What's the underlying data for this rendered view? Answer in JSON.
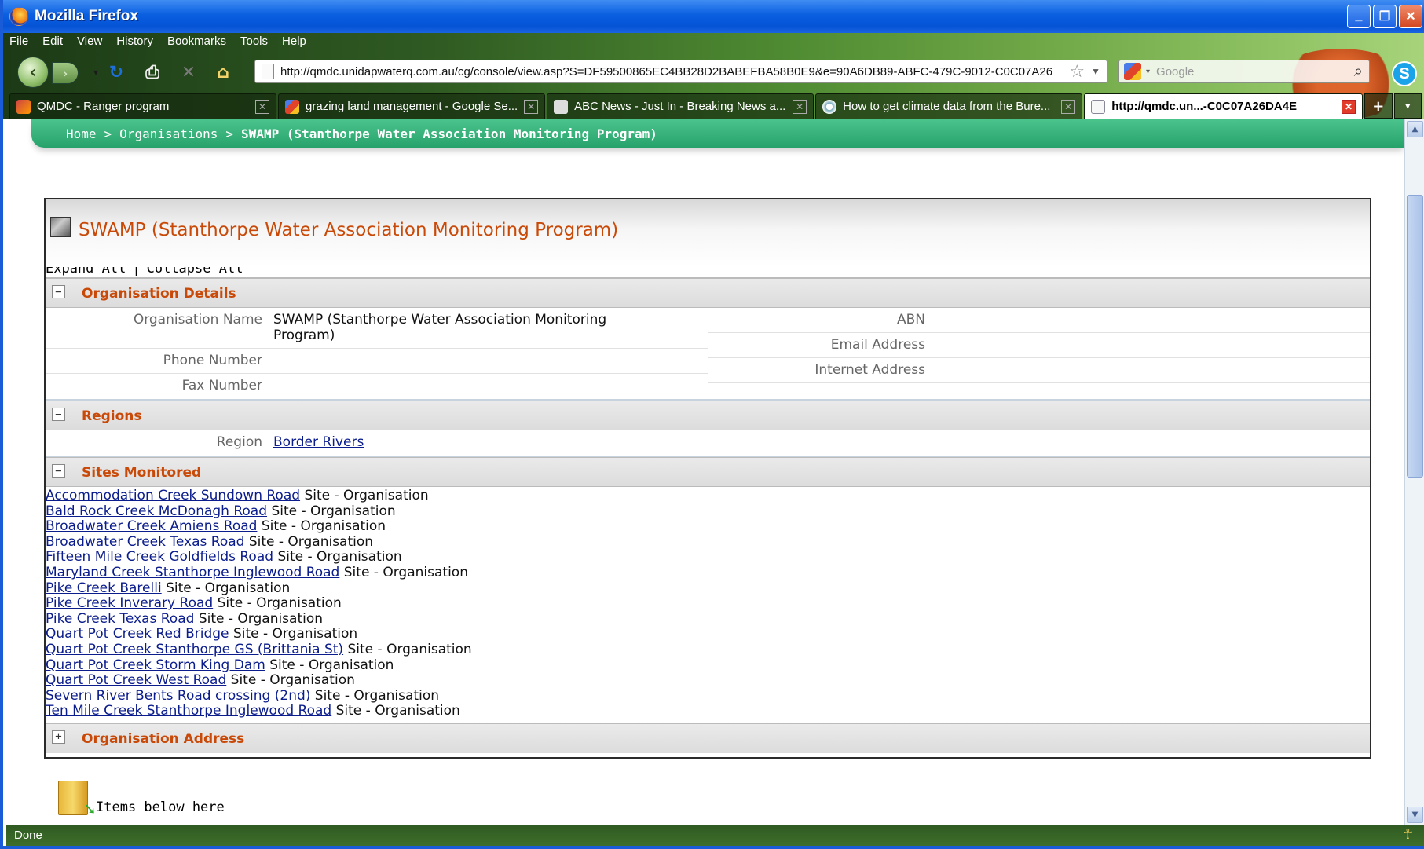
{
  "window": {
    "title": "Mozilla Firefox"
  },
  "menu": [
    "File",
    "Edit",
    "View",
    "History",
    "Bookmarks",
    "Tools",
    "Help"
  ],
  "navigation": {
    "url": "http://qmdc.unidapwaterq.com.au/cg/console/view.asp?S=DF59500865EC4BB28D2BABEFBA58B0E9&e=90A6DB89-ABFC-479C-9012-C0C07A26",
    "search_placeholder": "Google"
  },
  "tabs": [
    {
      "label": "QMDC - Ranger program",
      "icon": "ranger-icon"
    },
    {
      "label": "grazing land management - Google Se...",
      "icon": "google-icon"
    },
    {
      "label": "ABC News - Just In - Breaking News a...",
      "icon": "abc-icon"
    },
    {
      "label": "How to get climate data from the Bure...",
      "icon": "globe-icon"
    },
    {
      "label": "http://qmdc.un...-C0C07A26DA4E",
      "icon": "page-icon",
      "active": true
    }
  ],
  "breadcrumb": {
    "home": "Home",
    "sep1": ">",
    "organisations": "Organisations",
    "sep2": ">",
    "current": "SWAMP (Stanthorpe Water Association Monitoring Program)"
  },
  "panel": {
    "title": "SWAMP (Stanthorpe Water Association Monitoring Program)",
    "expand_all": "Expand All",
    "separator": "|",
    "collapse_all": "Collapse All"
  },
  "org_details": {
    "section_title": "Organisation Details",
    "toggle": "−",
    "left": [
      {
        "label": "Organisation Name",
        "value": "SWAMP (Stanthorpe Water Association Monitoring Program)"
      },
      {
        "label": "Phone Number",
        "value": ""
      },
      {
        "label": "Fax Number",
        "value": ""
      }
    ],
    "right": [
      {
        "label": "ABN",
        "value": ""
      },
      {
        "label": "Email Address",
        "value": ""
      },
      {
        "label": "Internet Address",
        "value": ""
      }
    ]
  },
  "regions": {
    "section_title": "Regions",
    "toggle": "−",
    "label": "Region",
    "value": "Border Rivers"
  },
  "sites": {
    "section_title": "Sites Monitored",
    "toggle": "−",
    "items": [
      {
        "name": "Accommodation Creek Sundown Road",
        "type": "Site - Organisation"
      },
      {
        "name": "Bald Rock Creek McDonagh Road",
        "type": "Site - Organisation"
      },
      {
        "name": "Broadwater Creek Amiens Road",
        "type": "Site - Organisation"
      },
      {
        "name": "Broadwater Creek Texas Road",
        "type": "Site - Organisation"
      },
      {
        "name": "Fifteen Mile Creek Goldfields Road",
        "type": "Site - Organisation"
      },
      {
        "name": "Maryland Creek Stanthorpe Inglewood Road",
        "type": "Site - Organisation"
      },
      {
        "name": "Pike Creek Barelli",
        "type": "Site - Organisation"
      },
      {
        "name": "Pike Creek Inverary Road",
        "type": "Site - Organisation"
      },
      {
        "name": "Pike Creek Texas Road",
        "type": "Site - Organisation"
      },
      {
        "name": "Quart Pot Creek Red Bridge",
        "type": "Site - Organisation"
      },
      {
        "name": "Quart Pot Creek Stanthorpe GS (Brittania St)",
        "type": "Site - Organisation"
      },
      {
        "name": "Quart Pot Creek Storm King Dam",
        "type": "Site - Organisation"
      },
      {
        "name": "Quart Pot Creek West Road",
        "type": "Site - Organisation"
      },
      {
        "name": "Severn River Bents Road crossing (2nd)",
        "type": "Site - Organisation"
      },
      {
        "name": "Ten Mile Creek Stanthorpe Inglewood Road",
        "type": "Site - Organisation"
      }
    ]
  },
  "org_address": {
    "section_title": "Organisation Address",
    "toggle": "+"
  },
  "items_below": "Items below here",
  "status": "Done"
}
